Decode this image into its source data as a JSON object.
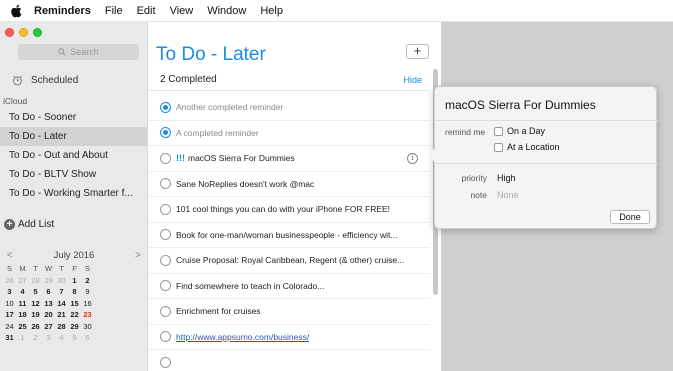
{
  "menubar": {
    "app_name": "Reminders",
    "items": [
      "File",
      "Edit",
      "View",
      "Window",
      "Help"
    ]
  },
  "sidebar": {
    "search_placeholder": "Search",
    "scheduled_label": "Scheduled",
    "account_label": "iCloud",
    "lists": [
      {
        "label": "To Do - Sooner",
        "selected": false
      },
      {
        "label": "To Do - Later",
        "selected": true
      },
      {
        "label": "To Do - Out and About",
        "selected": false
      },
      {
        "label": "To Do - BLTV Show",
        "selected": false
      },
      {
        "label": "To Do - Working Smarter f...",
        "selected": false
      }
    ],
    "add_list_label": "Add List"
  },
  "calendar": {
    "month_label": "July 2016",
    "prev": "<",
    "next": ">",
    "weekdays": [
      "S",
      "M",
      "T",
      "W",
      "T",
      "F",
      "S"
    ],
    "weeks": [
      [
        "26",
        "27",
        "28",
        "29",
        "30",
        "1",
        "2"
      ],
      [
        "3",
        "4",
        "5",
        "6",
        "7",
        "8",
        "9"
      ],
      [
        "10",
        "11",
        "12",
        "13",
        "14",
        "15",
        "16"
      ],
      [
        "17",
        "18",
        "19",
        "20",
        "21",
        "22",
        "23"
      ],
      [
        "24",
        "25",
        "26",
        "27",
        "28",
        "29",
        "30"
      ],
      [
        "31",
        "1",
        "2",
        "3",
        "4",
        "5",
        "6"
      ]
    ],
    "today": "23"
  },
  "main": {
    "title": "To Do - Later",
    "add_button": "+",
    "completed_count": "2 Completed",
    "hide_label": "Hide",
    "items": [
      {
        "text": "Another completed reminder",
        "done": true,
        "priority": "",
        "link": false,
        "info": false
      },
      {
        "text": "A completed reminder",
        "done": true,
        "priority": "",
        "link": false,
        "info": false
      },
      {
        "text": "macOS Sierra For Dummies",
        "done": false,
        "priority": "!!!",
        "link": false,
        "info": true
      },
      {
        "text": "Sane NoReplies doesn't work @mac",
        "done": false,
        "priority": "",
        "link": false,
        "info": false
      },
      {
        "text": "101 cool things you can do with your iPhone FOR FREE!",
        "done": false,
        "priority": "",
        "link": false,
        "info": false
      },
      {
        "text": "Book for one-man/woman businesspeople - efficiency wit...",
        "done": false,
        "priority": "",
        "link": false,
        "info": false
      },
      {
        "text": "Cruise Proposal: Royal Caribbean, Regent (& other) cruise...",
        "done": false,
        "priority": "",
        "link": false,
        "info": false
      },
      {
        "text": "Find somewhere to teach in Colorado...",
        "done": false,
        "priority": "",
        "link": false,
        "info": false
      },
      {
        "text": "Enrichment for cruises",
        "done": false,
        "priority": "",
        "link": false,
        "info": false
      },
      {
        "text": "http://www.appsumo.com/business/",
        "done": false,
        "priority": "",
        "link": true,
        "info": false
      },
      {
        "text": "",
        "done": false,
        "priority": "",
        "link": false,
        "info": false
      }
    ]
  },
  "popover": {
    "title": "macOS Sierra For Dummies",
    "remind_me_label": "remind me",
    "on_a_day": "On a Day",
    "at_a_location": "At a Location",
    "priority_label": "priority",
    "priority_value": "High",
    "note_label": "note",
    "note_value": "None",
    "done_button": "Done"
  },
  "colors": {
    "accent": "#1a8ce5",
    "today": "#e0301e",
    "desktop": "#cfcfcf"
  }
}
